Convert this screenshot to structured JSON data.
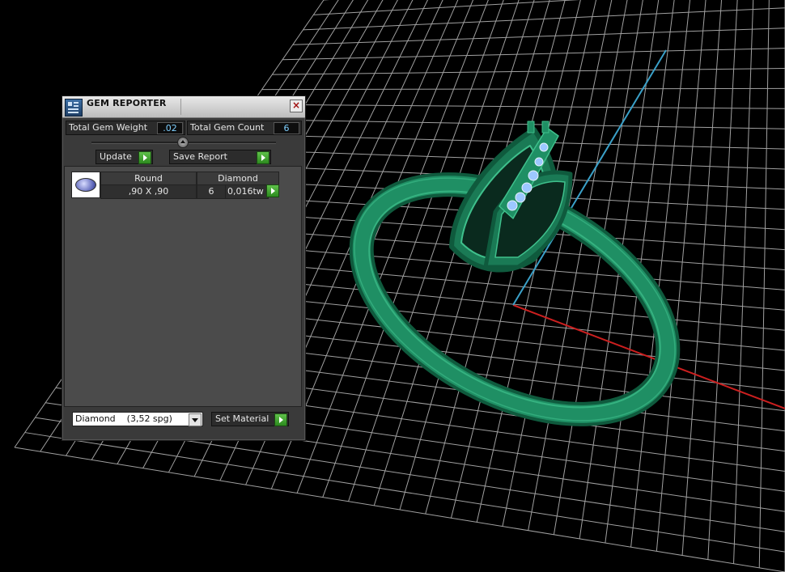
{
  "window": {
    "title": "GEM REPORTER",
    "close_label": "×"
  },
  "stats": {
    "total_weight_label": "Total Gem Weight",
    "total_weight_value": ".02",
    "total_count_label": "Total Gem Count",
    "total_count_value": "6"
  },
  "buttons": {
    "update_label": "Update",
    "save_report_label": "Save Report",
    "set_material_label": "Set Material"
  },
  "gem_list": {
    "rows": [
      {
        "icon": "round-gem-icon",
        "shape": "Round",
        "material": "Diamond",
        "size": ",90 X ,90",
        "count": "6",
        "weight": "0,016tw"
      }
    ]
  },
  "material_select": {
    "value": "Diamond    (3,52 spg)"
  },
  "colors": {
    "panel_bg": "#3a3a3a",
    "value_text": "#7fd0ff",
    "model_green": "#1f8f64",
    "grid_line": "#d0d0d0",
    "axis_x": "#cc1f1f",
    "axis_y": "#3aa0c8",
    "play_button": "#3fa02c"
  }
}
